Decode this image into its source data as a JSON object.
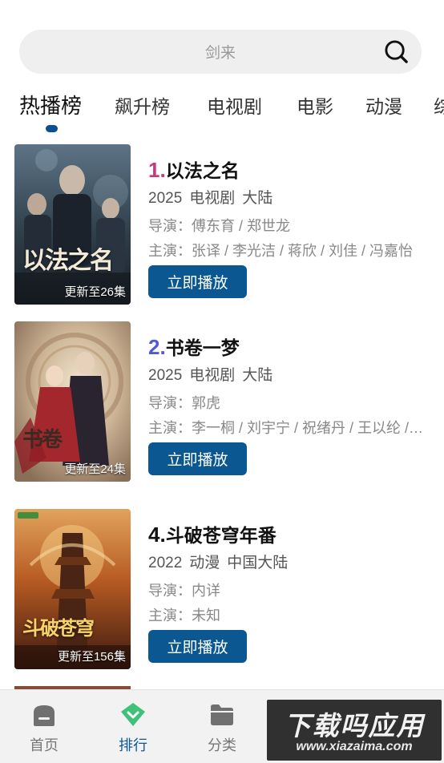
{
  "search": {
    "placeholder": "剑来",
    "icon": "search-icon"
  },
  "tabs": [
    {
      "label": "热播榜",
      "active": true
    },
    {
      "label": "飙升榜",
      "active": false
    },
    {
      "label": "电视剧",
      "active": false
    },
    {
      "label": "电影",
      "active": false
    },
    {
      "label": "动漫",
      "active": false
    },
    {
      "label": "综",
      "active": false
    }
  ],
  "items": [
    {
      "rank": "1.",
      "rank_color": "#c8387b",
      "title": "以法之名",
      "year": "2025",
      "category": "电视剧",
      "region": "大陆",
      "director": "导演：傅东育 / 郑世龙",
      "cast": "主演：张译 / 李光洁 / 蒋欣 / 刘佳 / 冯嘉怡",
      "update": "更新至26集",
      "poster_text": "以法之名",
      "play_label": "立即播放"
    },
    {
      "rank": "2.",
      "rank_color": "#4f5bd5",
      "title": "书卷一梦",
      "year": "2025",
      "category": "电视剧",
      "region": "大陆",
      "director": "导演：郭虎",
      "cast": "主演：李一桐 / 刘宇宁 / 祝绪丹 / 王以纶 / 蒋依依",
      "update": "更新至24集",
      "poster_text": "书卷",
      "play_label": "立即播放"
    },
    {
      "rank": "4.",
      "rank_color": "#111111",
      "title": "斗破苍穹年番",
      "year": "2022",
      "category": "动漫",
      "region": "中国大陆",
      "director": "导演：内详",
      "cast": "主演：未知",
      "update": "更新至156集",
      "poster_text": "斗破苍穹",
      "play_label": "立即播放"
    }
  ],
  "nav": [
    {
      "label": "首页",
      "icon": "home-icon",
      "active": false
    },
    {
      "label": "排行",
      "icon": "ranking-icon",
      "active": true
    },
    {
      "label": "分类",
      "icon": "folder-icon",
      "active": false
    }
  ],
  "watermark": {
    "main": "下载吗应用",
    "url": "www.xiazaima.com"
  }
}
